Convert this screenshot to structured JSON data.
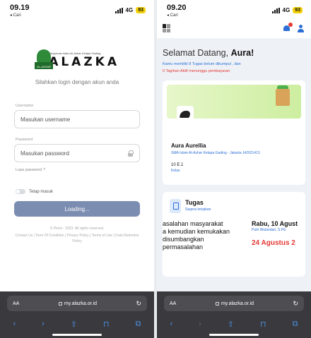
{
  "left": {
    "status": {
      "time": "09.19",
      "carrier": "◂ Cari",
      "network": "4G",
      "battery": "93"
    },
    "logo": {
      "mark_text": "AL-AZHAR",
      "subtitle": "Perguruan Islam Al-Azhar Kelapa Gading",
      "name": "ALAZKA"
    },
    "login_hint": "Silahkan login dengan akun anda",
    "username": {
      "label": "Username",
      "placeholder": "Masukan username"
    },
    "password": {
      "label": "Password",
      "placeholder": "Masukan password"
    },
    "forgot": "Lupa password ?",
    "remember": "Tetap masuk",
    "button": "Loading...",
    "copyright": "© Pinisi - 2023. All rights reserved.",
    "links": "Contact Us | Term Of Condition | Privacy Policy | Terms of Use | Data Retention Policy",
    "browser": {
      "aa": "AA",
      "url": "my.alazka.or.id"
    }
  },
  "right": {
    "status": {
      "time": "09.20",
      "carrier": "◂ Cari",
      "network": "4G",
      "battery": "93"
    },
    "welcome_prefix": "Selamat Datang, ",
    "welcome_name": "Aura!",
    "notice1": "Kamu memiliki 8 Tugas belum dikumpul , dan",
    "notice2": "0 Tagihan Aktif menunggu pembayaran",
    "profile": {
      "name": "Aura Aurellia",
      "school": "SMA Islam Al-Azhar Kelapa Gading - Jakarta J42021413",
      "class": "10 E.1",
      "class_label": "Kelas"
    },
    "task": {
      "title": "Tugas",
      "subtitle": "Segera kerjakan",
      "lines": [
        "asalahan masyarakat",
        "a kemudian kemukakan",
        "disumbangkan",
        "permasalahan"
      ],
      "date": "Rabu, 10 Agust",
      "teacher": "Putri Wulandari, S.Pd",
      "deadline": "24 Agustus 2"
    },
    "browser": {
      "aa": "AA",
      "url": "my.alazka.or.id"
    }
  },
  "icons": {
    "reload": "↻",
    "back": "‹",
    "forward": "›",
    "share": "⇪",
    "bookmarks": "⊓",
    "tabs": "⧉"
  }
}
